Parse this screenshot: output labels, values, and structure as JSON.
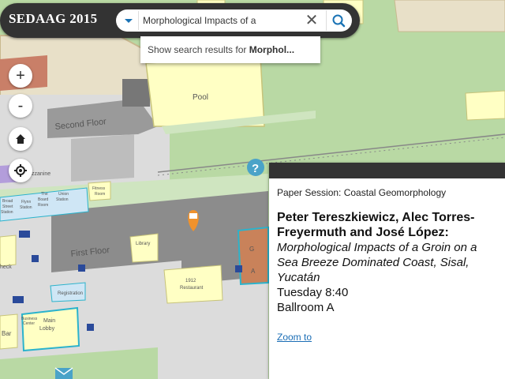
{
  "app": {
    "title": "SEDAAG 2015"
  },
  "search": {
    "value": "Morphological Impacts of a",
    "suggestion_prefix": "Show search results for ",
    "suggestion_bold": "Morphol..."
  },
  "controls": {
    "zoom_in": "+",
    "zoom_out": "-"
  },
  "map_labels": {
    "pool": "Pool",
    "second_floor": "Second Floor",
    "first_floor": "First Floor",
    "mezzanine": "zzanine",
    "library": "Library",
    "restaurant_1": "1912",
    "restaurant_2": "Restaurant",
    "registration": "Registration",
    "main_lobby_1": "Main",
    "main_lobby_2": "Lobby",
    "bar": "Bar",
    "fitness_1": "Fitness",
    "fitness_2": "Room",
    "board_room_1": "The",
    "board_room_2": "Board",
    "board_room_3": "Room",
    "union_station_1": "Union",
    "union_station_2": "Station",
    "flynn_station_1": "Flynn",
    "flynn_station_2": "Station",
    "broad_st_1": "Broad",
    "broad_st_2": "Street",
    "broad_st_3": "Station",
    "business_center_1": "Business",
    "business_center_2": "Center",
    "check": "heck",
    "ballroom": "G",
    "ballroom_b": "A"
  },
  "popup": {
    "session": "Paper Session: Coastal Geomorphology",
    "authors_line1": "Peter Tereszkiewicz, Alec Torres-",
    "authors_line2": "Freyermuth and José López:",
    "title_line1": "Morphological Impacts of a Groin on a",
    "title_line2": "Sea Breeze Dominated Coast, Sisal,",
    "title_line3": "Yucatán",
    "time": "Tuesday 8:40",
    "room": "Ballroom A",
    "zoom_link": "Zoom to"
  },
  "colors": {
    "park": "#b9d9a4",
    "building": "#f0ebd8",
    "floor": "#8c8c8c",
    "venue": "#ffffc4",
    "highlight": "#c9825a",
    "marker": "#f0922c",
    "info_marker": "#4aa3c8"
  }
}
